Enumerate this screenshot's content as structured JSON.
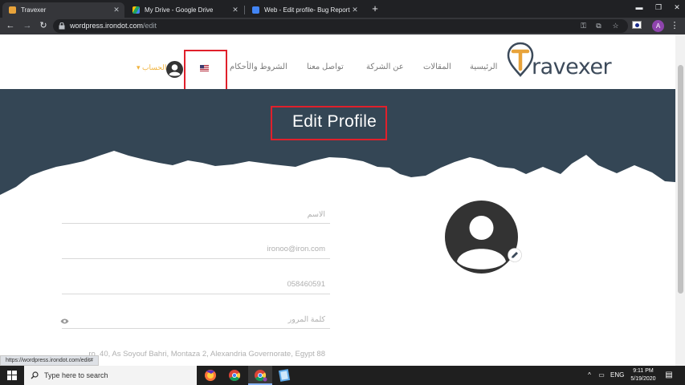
{
  "browser": {
    "tabs": [
      {
        "title": "Travexer",
        "favicon_color": "#e8a33a",
        "active": true
      },
      {
        "title": "My Drive - Google Drive",
        "favicon_color": "#1fa463",
        "active": false
      },
      {
        "title": "Web - Edit profile- Bug Report",
        "favicon_color": "#4285f4",
        "active": false
      }
    ],
    "new_tab_icon": "plus-icon",
    "url_domain": "wordpress.irondot.com",
    "url_path": "/edit",
    "profile_initial": "A"
  },
  "site": {
    "logo_text_T": "T",
    "logo_text_rest": "ravexer",
    "nav": {
      "home": "الرئيسية",
      "articles": "المقالات",
      "about": "عن الشركة",
      "contact": "تواصل معنا",
      "terms": "الشروط والأحكام",
      "account": "الحساب"
    },
    "flag_icon": "us-flag-icon",
    "page_title": "Edit Profile",
    "form": {
      "name_placeholder": "الاسم",
      "email": "ironoo@iron.com",
      "phone": "058460591",
      "password_placeholder": "كلمة المرور",
      "address": "...ro, 40, As Soyouf Bahri, Montaza 2, Alexandria Governorate, Egypt 88"
    },
    "colors": {
      "hero": "#344655",
      "accent": "#e8a33a",
      "highlight_box": "#e0202b"
    }
  },
  "status_bar_url": "https://wordpress.irondot.com/edit#",
  "taskbar": {
    "search_placeholder": "Type here to search",
    "language": "ENG",
    "time": "9:11 PM",
    "date": "5/19/2020"
  }
}
